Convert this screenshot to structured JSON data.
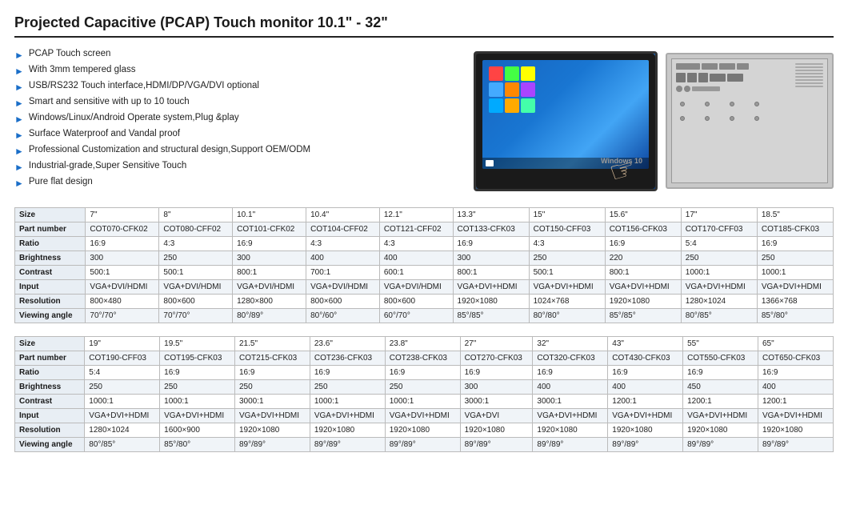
{
  "title": "Projected Capacitive (PCAP) Touch monitor 10.1\" - 32\"",
  "features": [
    "PCAP Touch screen",
    "With 3mm tempered glass",
    "USB/RS232 Touch interface,HDMI/DP/VGA/DVI optional",
    "Smart and sensitive with up to 10 touch",
    "Windows/Linux/Android Operate system,Plug &play",
    "Surface Waterproof and Vandal proof",
    "Professional Customization and structural design,Support OEM/ODM",
    "Industrial-grade,Super Sensitive Touch",
    "Pure flat design"
  ],
  "table1": {
    "headers": [
      "",
      "7\"",
      "8\"",
      "10.1\"",
      "10.4\"",
      "12.1\"",
      "13.3\"",
      "15\"",
      "15.6\"",
      "17\"",
      "18.5\""
    ],
    "rows": [
      [
        "Size",
        "7\"",
        "8\"",
        "10.1\"",
        "10.4\"",
        "12.1\"",
        "13.3\"",
        "15\"",
        "15.6\"",
        "17\"",
        "18.5\""
      ],
      [
        "Part number",
        "COT070-CFK02",
        "COT080-CFF02",
        "COT101-CFK02",
        "COT104-CFF02",
        "COT121-CFF02",
        "COT133-CFK03",
        "COT150-CFF03",
        "COT156-CFK03",
        "COT170-CFF03",
        "COT185-CFK03"
      ],
      [
        "Ratio",
        "16:9",
        "4:3",
        "16:9",
        "4:3",
        "4:3",
        "16:9",
        "4:3",
        "16:9",
        "5:4",
        "16:9"
      ],
      [
        "Brightness",
        "300",
        "250",
        "300",
        "400",
        "400",
        "300",
        "250",
        "220",
        "250",
        "250"
      ],
      [
        "Contrast",
        "500:1",
        "500:1",
        "800:1",
        "700:1",
        "600:1",
        "800:1",
        "500:1",
        "800:1",
        "1000:1",
        "1000:1"
      ],
      [
        "Input",
        "VGA+DVI/HDMI",
        "VGA+DVI/HDMI",
        "VGA+DVI/HDMI",
        "VGA+DVI/HDMI",
        "VGA+DVI/HDMI",
        "VGA+DVI+HDMI",
        "VGA+DVI+HDMI",
        "VGA+DVI+HDMI",
        "VGA+DVI+HDMI",
        "VGA+DVI+HDMI"
      ],
      [
        "Resolution",
        "800×480",
        "800×600",
        "1280×800",
        "800×600",
        "800×600",
        "1920×1080",
        "1024×768",
        "1920×1080",
        "1280×1024",
        "1366×768"
      ],
      [
        "Viewing angle",
        "70°/70°",
        "70°/70°",
        "80°/89°",
        "80°/60°",
        "60°/70°",
        "85°/85°",
        "80°/80°",
        "85°/85°",
        "80°/85°",
        "85°/80°"
      ]
    ]
  },
  "table2": {
    "headers": [
      "",
      "19\"",
      "19.5\"",
      "21.5\"",
      "23.6\"",
      "23.8\"",
      "27\"",
      "32\"",
      "43\"",
      "55\"",
      "65\""
    ],
    "rows": [
      [
        "Size",
        "19\"",
        "19.5\"",
        "21.5\"",
        "23.6\"",
        "23.8\"",
        "27\"",
        "32\"",
        "43\"",
        "55\"",
        "65\""
      ],
      [
        "Part number",
        "COT190-CFF03",
        "COT195-CFK03",
        "COT215-CFK03",
        "COT236-CFK03",
        "COT238-CFK03",
        "COT270-CFK03",
        "COT320-CFK03",
        "COT430-CFK03",
        "COT550-CFK03",
        "COT650-CFK03"
      ],
      [
        "Ratio",
        "5:4",
        "16:9",
        "16:9",
        "16:9",
        "16:9",
        "16:9",
        "16:9",
        "16:9",
        "16:9",
        "16:9"
      ],
      [
        "Brightness",
        "250",
        "250",
        "250",
        "250",
        "250",
        "300",
        "400",
        "400",
        "450",
        "400"
      ],
      [
        "Contrast",
        "1000:1",
        "1000:1",
        "3000:1",
        "1000:1",
        "1000:1",
        "3000:1",
        "3000:1",
        "1200:1",
        "1200:1",
        "1200:1"
      ],
      [
        "Input",
        "VGA+DVI+HDMI",
        "VGA+DVI+HDMI",
        "VGA+DVI+HDMI",
        "VGA+DVI+HDMI",
        "VGA+DVI+HDMI",
        "VGA+DVI",
        "VGA+DVI+HDMI",
        "VGA+DVI+HDMI",
        "VGA+DVI+HDMI",
        "VGA+DVI+HDMI"
      ],
      [
        "Resolution",
        "1280×1024",
        "1600×900",
        "1920×1080",
        "1920×1080",
        "1920×1080",
        "1920×1080",
        "1920×1080",
        "1920×1080",
        "1920×1080",
        "1920×1080"
      ],
      [
        "Viewing angle",
        "80°/85°",
        "85°/80°",
        "89°/89°",
        "89°/89°",
        "89°/89°",
        "89°/89°",
        "89°/89°",
        "89°/89°",
        "89°/89°",
        "89°/89°"
      ]
    ]
  }
}
